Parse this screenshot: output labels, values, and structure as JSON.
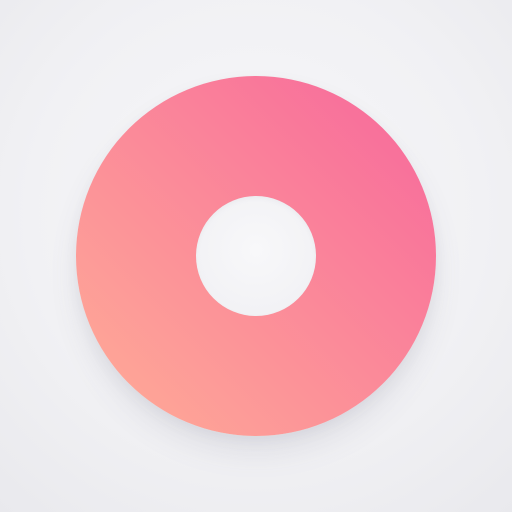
{
  "colors": {
    "background": "#f2f2f5",
    "ring_gradient_start": "#ffae96",
    "ring_gradient_end": "#f7669c"
  },
  "icon": {
    "name": "donut-ring-icon"
  }
}
